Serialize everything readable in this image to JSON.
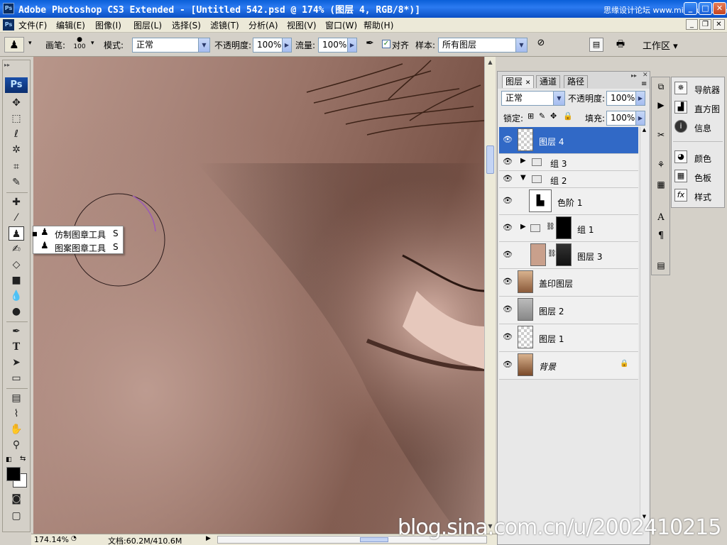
{
  "window": {
    "title": "Adobe Photoshop CS3 Extended - [Untitled 542.psd @ 174% (图层 4, RGB/8*)]",
    "app_icon": "Ps",
    "watermark_top": "思缘设计论坛 www.missyuan.com"
  },
  "menu": {
    "items": [
      "文件(F)",
      "编辑(E)",
      "图像(I)",
      "图层(L)",
      "选择(S)",
      "滤镜(T)",
      "分析(A)",
      "视图(V)",
      "窗口(W)",
      "帮助(H)"
    ]
  },
  "options": {
    "brush_label": "画笔:",
    "brush_size": "100",
    "mode_label": "模式:",
    "mode_value": "正常",
    "opacity_label": "不透明度:",
    "opacity_value": "100%",
    "flow_label": "流量:",
    "flow_value": "100%",
    "aligned_label": "对齐",
    "aligned_checked": true,
    "sample_label": "样本:",
    "sample_value": "所有图层",
    "workspace_label": "工作区 ▾"
  },
  "toolbox": {
    "logo": "Ps",
    "flyout": [
      {
        "label": "仿制图章工具",
        "key": "S",
        "selected": true
      },
      {
        "label": "图案图章工具",
        "key": "S",
        "selected": false
      }
    ]
  },
  "status": {
    "zoom": "174.14%",
    "doc": "文档:60.2M/410.6M"
  },
  "layers_panel": {
    "tabs": [
      "图层",
      "通道",
      "路径"
    ],
    "blend_mode": "正常",
    "opacity_label": "不透明度:",
    "opacity_value": "100%",
    "lock_label": "锁定:",
    "fill_label": "填充:",
    "fill_value": "100%",
    "layers": [
      {
        "name": "图层 4",
        "type": "layer",
        "selected": true
      },
      {
        "name": "组 3",
        "type": "group",
        "expanded": false
      },
      {
        "name": "组 2",
        "type": "group",
        "expanded": true
      },
      {
        "name": "色阶 1",
        "type": "adjustment"
      },
      {
        "name": "组 1",
        "type": "group-mask",
        "expanded": false
      },
      {
        "name": "图层 3",
        "type": "masked-layer"
      },
      {
        "name": "盖印图层",
        "type": "layer"
      },
      {
        "name": "图层 2",
        "type": "layer"
      },
      {
        "name": "图层 1",
        "type": "layer"
      },
      {
        "name": "背景",
        "type": "background",
        "locked": true
      }
    ]
  },
  "dock": {
    "items": [
      "导航器",
      "直方图",
      "信息",
      "颜色",
      "色板",
      "样式"
    ]
  },
  "watermark": "blog.sina.com.cn/u/2002410215",
  "colors": {
    "titlebar": "#0a5fd8",
    "selection": "#3169c6",
    "brush_cursor": "#9b59b6"
  }
}
